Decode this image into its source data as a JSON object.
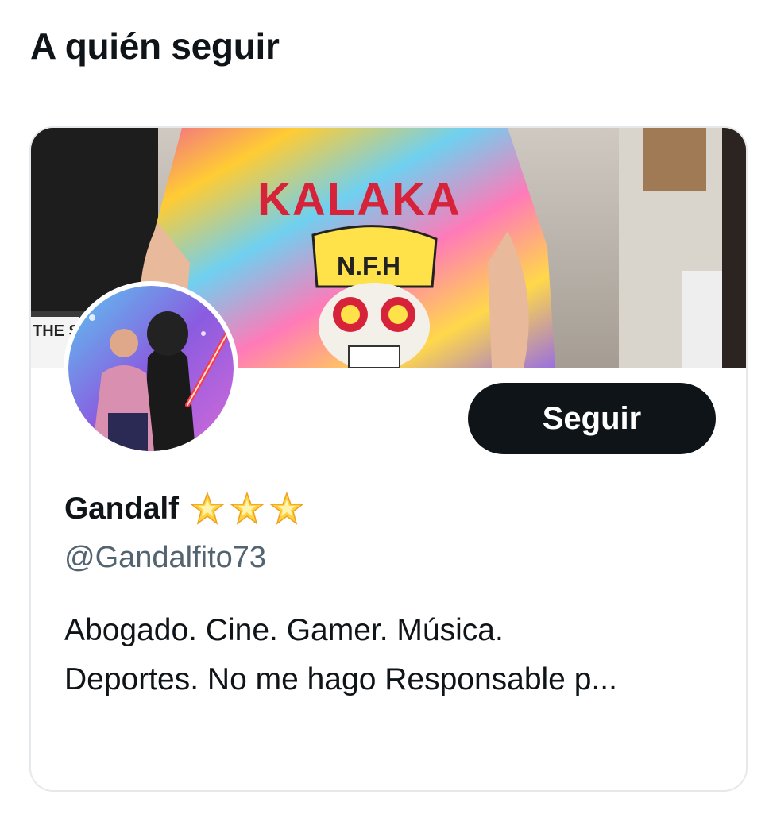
{
  "section": {
    "title": "A quién seguir"
  },
  "suggestion": {
    "banner_text": "KALAKA",
    "cap_text": "N.F.H",
    "sign_text": "THE ST",
    "follow_label": "Seguir",
    "display_name": "Gandalf",
    "name_decoration": "glowing-star-icon x3",
    "handle": "@Gandalfito73",
    "bio_lines": [
      "Abogado. Cine. Gamer. Música.",
      "Deportes. No me hago Responsable p..."
    ]
  },
  "colors": {
    "text_primary": "#0f1419",
    "text_secondary": "#536471",
    "button_bg": "#0f1419",
    "button_text": "#ffffff",
    "card_border": "#e6e9ec",
    "star": "#ffd23f"
  }
}
